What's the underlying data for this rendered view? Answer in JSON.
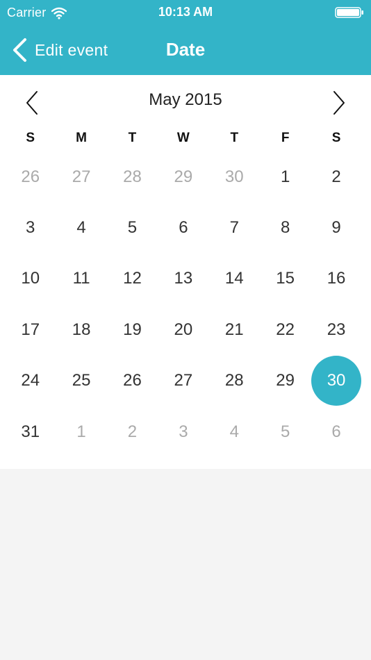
{
  "status_bar": {
    "carrier": "Carrier",
    "time": "10:13 AM"
  },
  "nav": {
    "back_label": "Edit event",
    "title": "Date"
  },
  "calendar": {
    "month_title": "May 2015",
    "weekdays": [
      "S",
      "M",
      "T",
      "W",
      "T",
      "F",
      "S"
    ],
    "selected_day": "30",
    "days": [
      {
        "label": "26",
        "current_month": false
      },
      {
        "label": "27",
        "current_month": false
      },
      {
        "label": "28",
        "current_month": false
      },
      {
        "label": "29",
        "current_month": false
      },
      {
        "label": "30",
        "current_month": false
      },
      {
        "label": "1",
        "current_month": true
      },
      {
        "label": "2",
        "current_month": true
      },
      {
        "label": "3",
        "current_month": true
      },
      {
        "label": "4",
        "current_month": true
      },
      {
        "label": "5",
        "current_month": true
      },
      {
        "label": "6",
        "current_month": true
      },
      {
        "label": "7",
        "current_month": true
      },
      {
        "label": "8",
        "current_month": true
      },
      {
        "label": "9",
        "current_month": true
      },
      {
        "label": "10",
        "current_month": true
      },
      {
        "label": "11",
        "current_month": true
      },
      {
        "label": "12",
        "current_month": true
      },
      {
        "label": "13",
        "current_month": true
      },
      {
        "label": "14",
        "current_month": true
      },
      {
        "label": "15",
        "current_month": true
      },
      {
        "label": "16",
        "current_month": true
      },
      {
        "label": "17",
        "current_month": true
      },
      {
        "label": "18",
        "current_month": true
      },
      {
        "label": "19",
        "current_month": true
      },
      {
        "label": "20",
        "current_month": true
      },
      {
        "label": "21",
        "current_month": true
      },
      {
        "label": "22",
        "current_month": true
      },
      {
        "label": "23",
        "current_month": true
      },
      {
        "label": "24",
        "current_month": true
      },
      {
        "label": "25",
        "current_month": true
      },
      {
        "label": "26",
        "current_month": true
      },
      {
        "label": "27",
        "current_month": true
      },
      {
        "label": "28",
        "current_month": true
      },
      {
        "label": "29",
        "current_month": true
      },
      {
        "label": "30",
        "current_month": true,
        "selected": true
      },
      {
        "label": "31",
        "current_month": true
      },
      {
        "label": "1",
        "current_month": false
      },
      {
        "label": "2",
        "current_month": false
      },
      {
        "label": "3",
        "current_month": false
      },
      {
        "label": "4",
        "current_month": false
      },
      {
        "label": "5",
        "current_month": false
      },
      {
        "label": "6",
        "current_month": false
      }
    ]
  },
  "icons": {
    "wifi": "wifi-icon",
    "battery": "battery-icon",
    "back": "chevron-left-icon",
    "prev_month": "chevron-left-icon",
    "next_month": "chevron-right-icon"
  },
  "colors": {
    "accent": "#33b4c8",
    "background": "#f4f4f4",
    "calendar_background": "#ffffff",
    "text": "#333333",
    "muted_text": "#aaaaaa"
  }
}
